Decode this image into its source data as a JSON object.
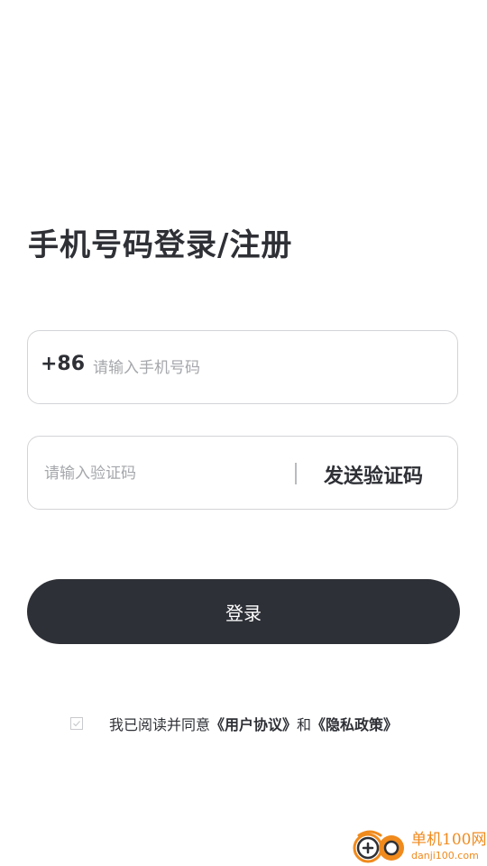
{
  "login": {
    "title": "手机号码登录/注册",
    "phone": {
      "country_code": "+86",
      "placeholder": "请输入手机号码",
      "value": ""
    },
    "code": {
      "placeholder": "请输入验证码",
      "value": "",
      "send_label": "发送验证码"
    },
    "submit_label": "登录",
    "agreement": {
      "checked": false,
      "prefix": "我已阅读并同意",
      "user_agreement": "《用户协议》",
      "conjunction": "和",
      "privacy_policy": "《隐私政策》"
    }
  },
  "watermark": {
    "name": "单机100网",
    "domain": "danji100.com"
  },
  "colors": {
    "text": "#2e3036",
    "button_bg": "#2e3037",
    "border": "#d3d4d7",
    "placeholder": "#a5a7ab",
    "watermark": "#f08a1c"
  },
  "icons": {
    "checkbox": "check-icon",
    "watermark_logo": "danji100-logo-icon"
  }
}
